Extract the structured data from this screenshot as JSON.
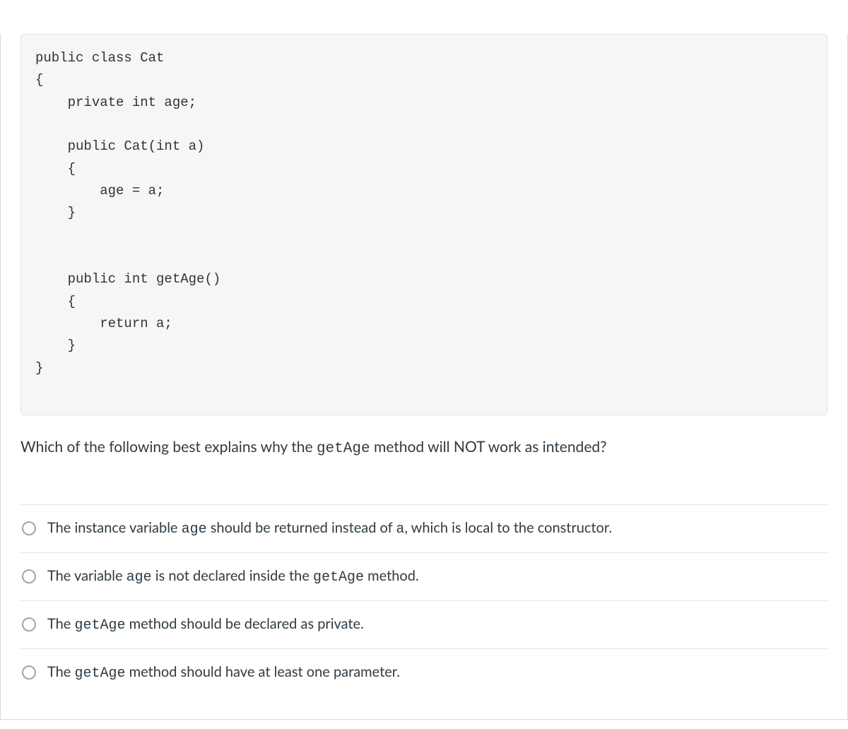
{
  "code": "public class Cat\n{\n    private int age;\n\n    public Cat(int a)\n    {\n        age = a;\n    }\n\n\n    public int getAge()\n    {\n        return a;\n    }\n}",
  "question": {
    "part1": "Which of the following best explains why the ",
    "code1": "getAge",
    "part2": " method will NOT work as intended?"
  },
  "answers": [
    {
      "segments": [
        {
          "t": "text",
          "v": "The instance variable "
        },
        {
          "t": "code",
          "v": "age"
        },
        {
          "t": "text",
          "v": " should be returned instead of "
        },
        {
          "t": "code",
          "v": "a"
        },
        {
          "t": "text",
          "v": ", which is local to the constructor."
        }
      ]
    },
    {
      "segments": [
        {
          "t": "text",
          "v": "The variable "
        },
        {
          "t": "code",
          "v": "age"
        },
        {
          "t": "text",
          "v": " is not declared inside the "
        },
        {
          "t": "code",
          "v": "getAge"
        },
        {
          "t": "text",
          "v": " method."
        }
      ]
    },
    {
      "segments": [
        {
          "t": "text",
          "v": "The "
        },
        {
          "t": "code",
          "v": "getAge"
        },
        {
          "t": "text",
          "v": "  method should be declared as private."
        }
      ]
    },
    {
      "segments": [
        {
          "t": "text",
          "v": "The "
        },
        {
          "t": "code",
          "v": "getAge"
        },
        {
          "t": "text",
          "v": " method should have at least one parameter."
        }
      ]
    }
  ]
}
